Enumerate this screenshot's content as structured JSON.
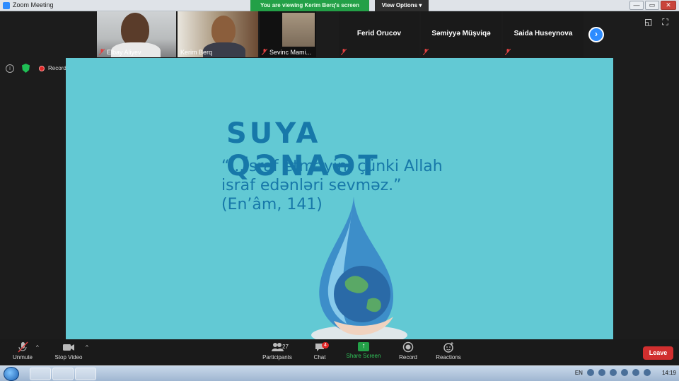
{
  "window": {
    "title": "Zoom Meeting",
    "share_banner": "You are viewing Kerim Berq's screen",
    "view_options": "View Options",
    "minimize": "—",
    "maximize": "▭",
    "close": "✕"
  },
  "participants_strip": [
    {
      "name": "Elbay Aliyev",
      "has_video": true
    },
    {
      "name": "Kerim Berq",
      "has_video": true
    },
    {
      "name": "Sevinc Mami...",
      "has_video": true
    },
    {
      "name": "Ferid Orucov",
      "has_video": false
    },
    {
      "name": "Səmiyyə Müşviqə",
      "has_video": false
    },
    {
      "name": "Saida Huseynova",
      "has_video": false
    }
  ],
  "status": {
    "recording_label": "Recording"
  },
  "slide": {
    "title": "SUYA QƏNAƏT",
    "quote_lines": [
      "“...İsraf etməyin; çünki Allah",
      "israf edənləri sevməz.”",
      "(En’âm, 141)"
    ]
  },
  "toolbar": {
    "unmute": "Unmute",
    "stop_video": "Stop Video",
    "participants": "Participants",
    "participants_count": "27",
    "chat": "Chat",
    "chat_badge": "4",
    "share_screen": "Share Screen",
    "record": "Record",
    "reactions": "Reactions",
    "leave": "Leave"
  },
  "taskbar": {
    "language": "EN",
    "clock": "14:19"
  },
  "colors": {
    "accent": "#2d8cff",
    "share_green": "#23a047",
    "slide_bg": "#62c9d4",
    "slide_text": "#1778a9",
    "leave_red": "#d12f2f"
  }
}
